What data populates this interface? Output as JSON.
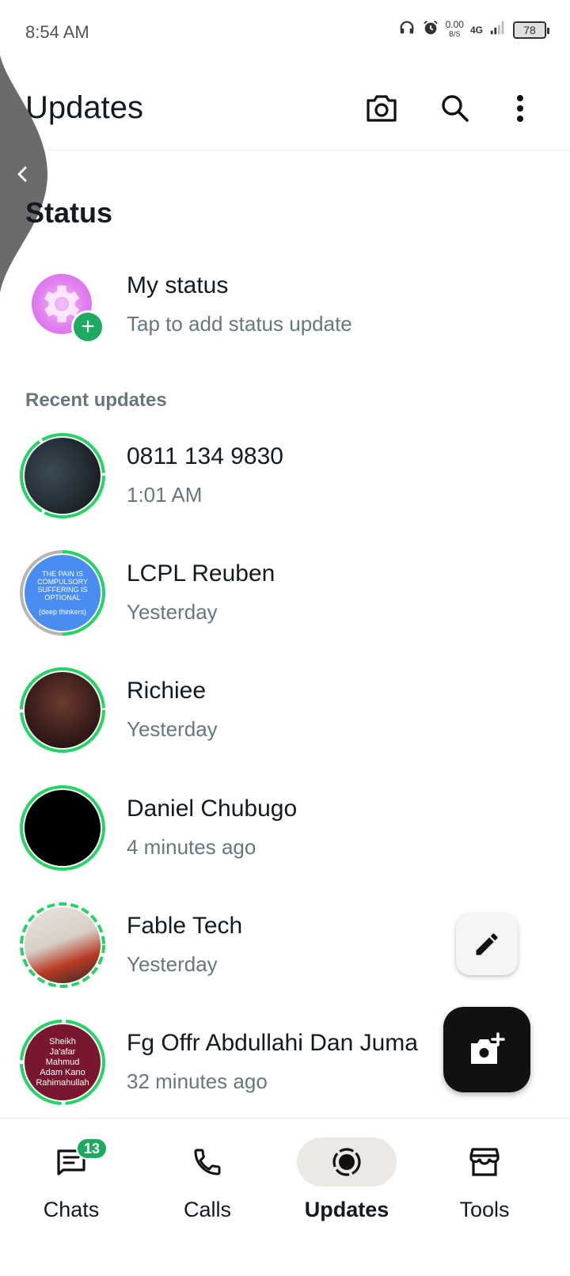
{
  "status_bar": {
    "time": "8:54 AM",
    "net_speed_value": "0.00",
    "net_speed_unit": "B/S",
    "network": "4G",
    "battery": "78"
  },
  "header": {
    "title": "Updates",
    "icons": [
      "camera-icon",
      "search-icon",
      "more-vert-icon"
    ]
  },
  "status_section": {
    "title": "Status",
    "my_status": {
      "name": "My status",
      "subtitle": "Tap to add status update"
    },
    "recent_label": "Recent updates",
    "updates": [
      {
        "name": "0811 134 9830",
        "time": "1:01 AM"
      },
      {
        "name": "LCPL Reuben",
        "time": "Yesterday",
        "thumbnail_text": [
          "THE PAIN IS",
          "COMPULSORY",
          "SUFFERING IS",
          "OPTIONAL",
          "(deep thinkers)"
        ]
      },
      {
        "name": "Richiee",
        "time": "Yesterday"
      },
      {
        "name": "Daniel Chubugo",
        "time": "4 minutes ago"
      },
      {
        "name": "Fable Tech",
        "time": "Yesterday"
      },
      {
        "name": "Fg Offr Abdullahi Dan Juma",
        "time": "32 minutes ago",
        "thumbnail_text": [
          "Sheikh",
          "Ja'afar",
          "Mahmud",
          "Adam Kano",
          "Rahimahullah"
        ]
      }
    ]
  },
  "bottom_nav": {
    "items": [
      {
        "label": "Chats",
        "icon": "chats-icon",
        "badge": "13"
      },
      {
        "label": "Calls",
        "icon": "phone-icon"
      },
      {
        "label": "Updates",
        "icon": "updates-icon",
        "active": true
      },
      {
        "label": "Tools",
        "icon": "store-icon"
      }
    ]
  },
  "colors": {
    "accent_green": "#1daa61",
    "ring_green": "#25d366",
    "muted_text": "#667781"
  }
}
